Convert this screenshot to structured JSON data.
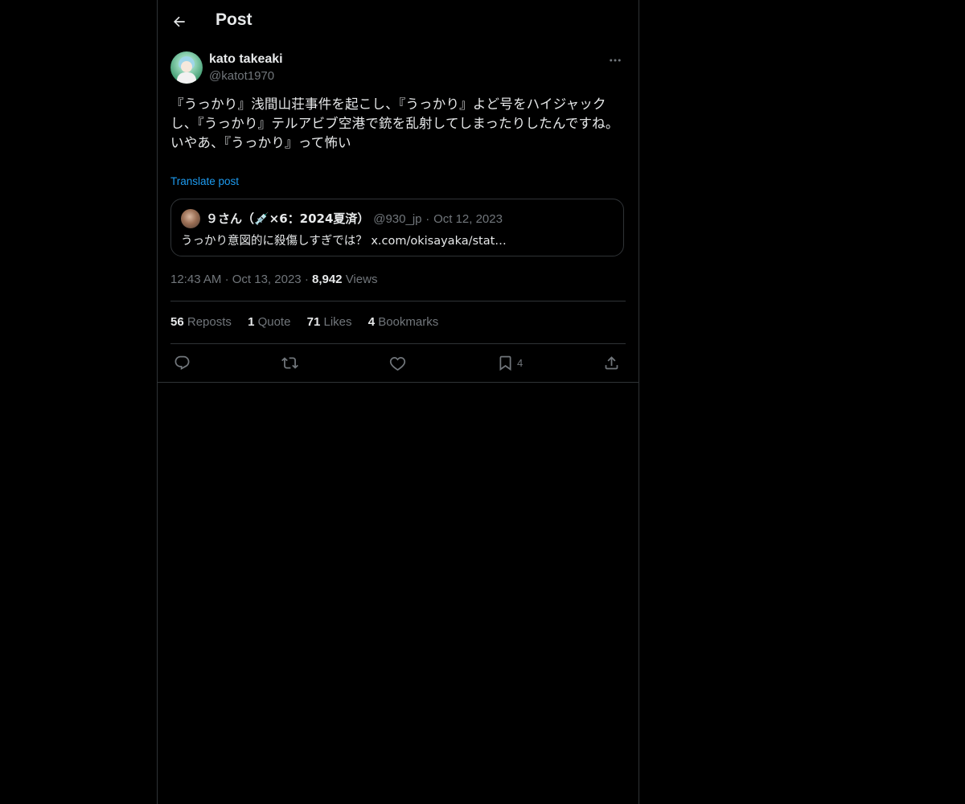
{
  "header": {
    "title": "Post",
    "back_icon": "arrow-left-icon"
  },
  "author": {
    "display_name": "kato takeaki",
    "handle": "@katot1970",
    "more_icon": "more-horizontal-icon"
  },
  "post": {
    "text": "『うっかり』浅間山荘事件を起こし、『うっかり』よど号をハイジャックし、『うっかり』テルアビブ空港で銃を乱射してしまったりしたんですね。\nいやあ、『うっかり』って怖い",
    "translate_label": "Translate post"
  },
  "quote": {
    "name": "９さん（💉×6：2024夏済）",
    "handle": "@930_jp",
    "dot": "·",
    "date": "Oct 12, 2023",
    "text": "うっかり意図的に殺傷しすぎでは？ x.com/okisayaka/stat…"
  },
  "meta": {
    "time": "12:43 AM",
    "sep1": "·",
    "date": "Oct 13, 2023",
    "sep2": "·",
    "views_count": "8,942",
    "views_label": "Views"
  },
  "stats": [
    {
      "num": "56",
      "label": "Reposts"
    },
    {
      "num": "1",
      "label": "Quote"
    },
    {
      "num": "71",
      "label": "Likes"
    },
    {
      "num": "4",
      "label": "Bookmarks"
    }
  ],
  "actions": {
    "reply_icon": "reply-icon",
    "repost_icon": "repost-icon",
    "like_icon": "heart-icon",
    "bookmark_icon": "bookmark-icon",
    "bookmark_count": "4",
    "share_icon": "share-icon"
  },
  "colors": {
    "background": "#000000",
    "text": "#e7e9ea",
    "muted": "#71767b",
    "link": "#1d9bf0",
    "border": "#2f3336"
  }
}
